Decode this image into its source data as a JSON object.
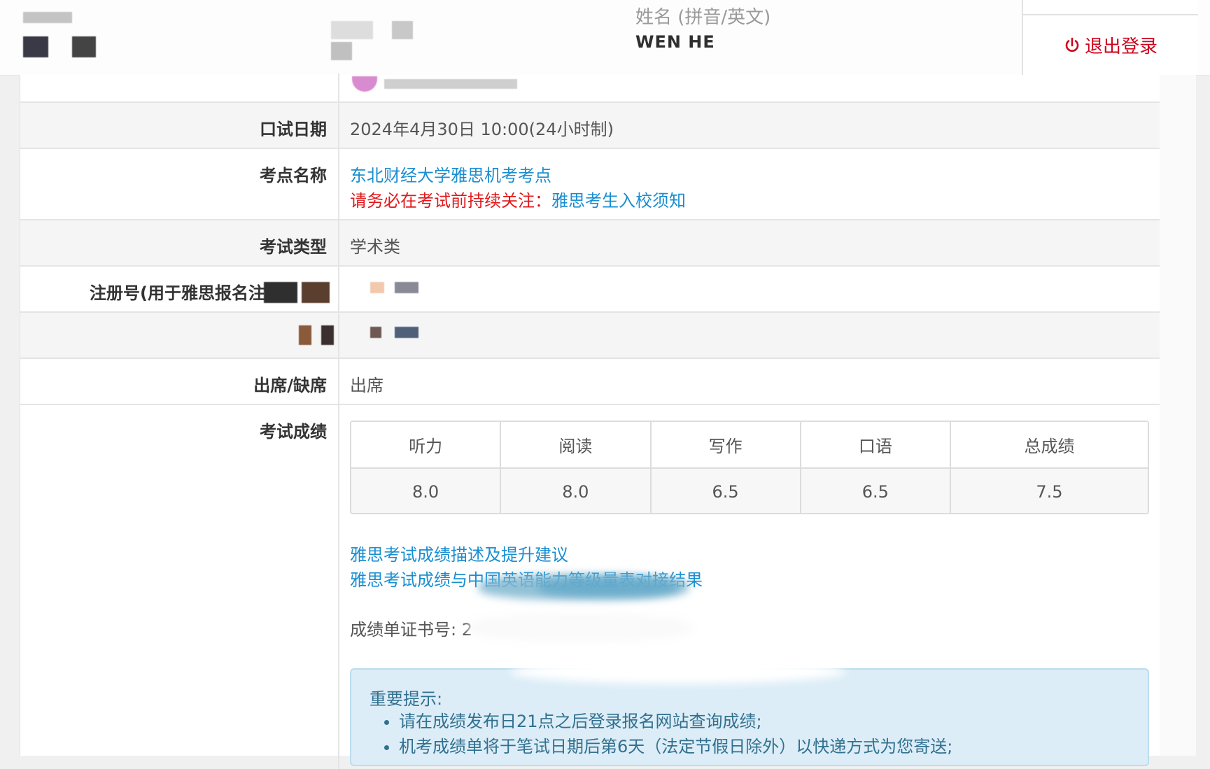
{
  "header": {
    "name_label": "姓名 (拼音/英文)",
    "name_value": "WEN  HE",
    "logout_label": "退出登录"
  },
  "rows": {
    "oral_date": {
      "label": "口试日期",
      "value": "2024年4月30日 10:00(24小时制)"
    },
    "venue": {
      "label": "考点名称",
      "name": "东北财经大学雅思机考考点",
      "notice_prefix": "请务必在考试前持续关注：",
      "notice_link": "雅思考生入校须知"
    },
    "exam_type": {
      "label": "考试类型",
      "value": "学术类"
    },
    "registration": {
      "label": "注册号(用于雅思报名注册"
    },
    "attendance": {
      "label": "出席/缺席",
      "value": "出席"
    },
    "scores": {
      "label": "考试成绩"
    }
  },
  "score_table": {
    "headers": [
      "听力",
      "阅读",
      "写作",
      "口语",
      "总成绩"
    ],
    "values": [
      "8.0",
      "8.0",
      "6.5",
      "6.5",
      "7.5"
    ]
  },
  "links": {
    "score_description": "雅思考试成绩描述及提升建议",
    "cse_mapping": "雅思考试成绩与中国英语能力等级量表对接结果"
  },
  "certificate_label": "成绩单证书号: 2",
  "notice": {
    "title": "重要提示:",
    "items": [
      "请在成绩发布日21点之后登录报名网站查询成绩;",
      "机考成绩单将于笔试日期后第6天（法定节假日除外）以快递方式为您寄送;"
    ]
  },
  "colors": {
    "link": "#1a8ed1",
    "warning": "#e0191b",
    "logout": "#d0021b",
    "notice_bg": "#dcedf7"
  }
}
